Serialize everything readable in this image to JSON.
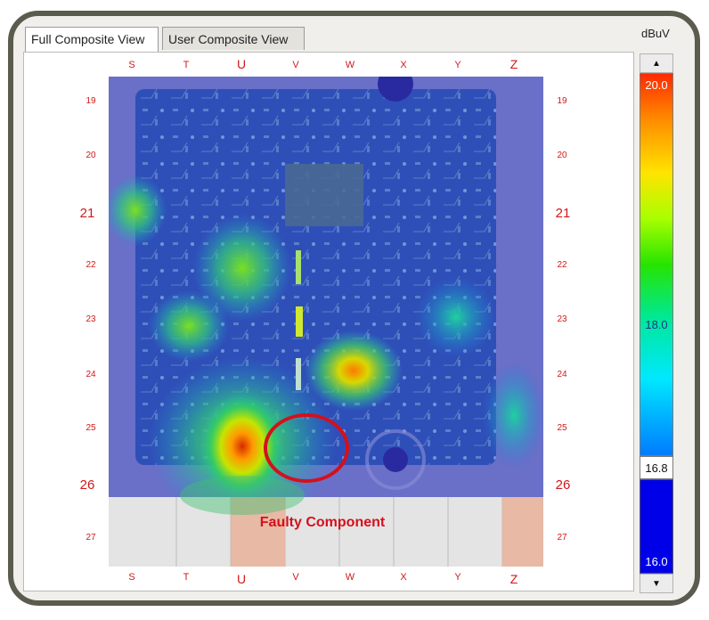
{
  "tabs": [
    {
      "label": "Full Composite View",
      "active": true
    },
    {
      "label": "User Composite View",
      "active": false
    }
  ],
  "unit": "dBuV",
  "grid": {
    "columns": [
      "S",
      "T",
      "U",
      "V",
      "W",
      "X",
      "Y",
      "Z"
    ],
    "rows": [
      "19",
      "20",
      "21",
      "22",
      "23",
      "24",
      "25",
      "26",
      "27"
    ]
  },
  "annotation": {
    "label": "Faulty Component",
    "color": "#d4101c"
  },
  "colorbar": {
    "max_label": "20.0",
    "mid_label": "18.0",
    "threshold_label": "16.8",
    "min_label": "16.0",
    "colors": [
      "#ff2a00",
      "#ffe400",
      "#26e400",
      "#00e8ff",
      "#007bff",
      "#0000e8"
    ],
    "scroll_up_icon": "up-arrow-icon",
    "scroll_down_icon": "down-arrow-icon"
  },
  "hotspots": [
    {
      "name": "strongest",
      "column": "U",
      "row": "25.5",
      "level_dbuv": 20.0
    },
    {
      "name": "secondary",
      "column": "W",
      "row": "24",
      "level_dbuv": 19.5
    }
  ]
}
